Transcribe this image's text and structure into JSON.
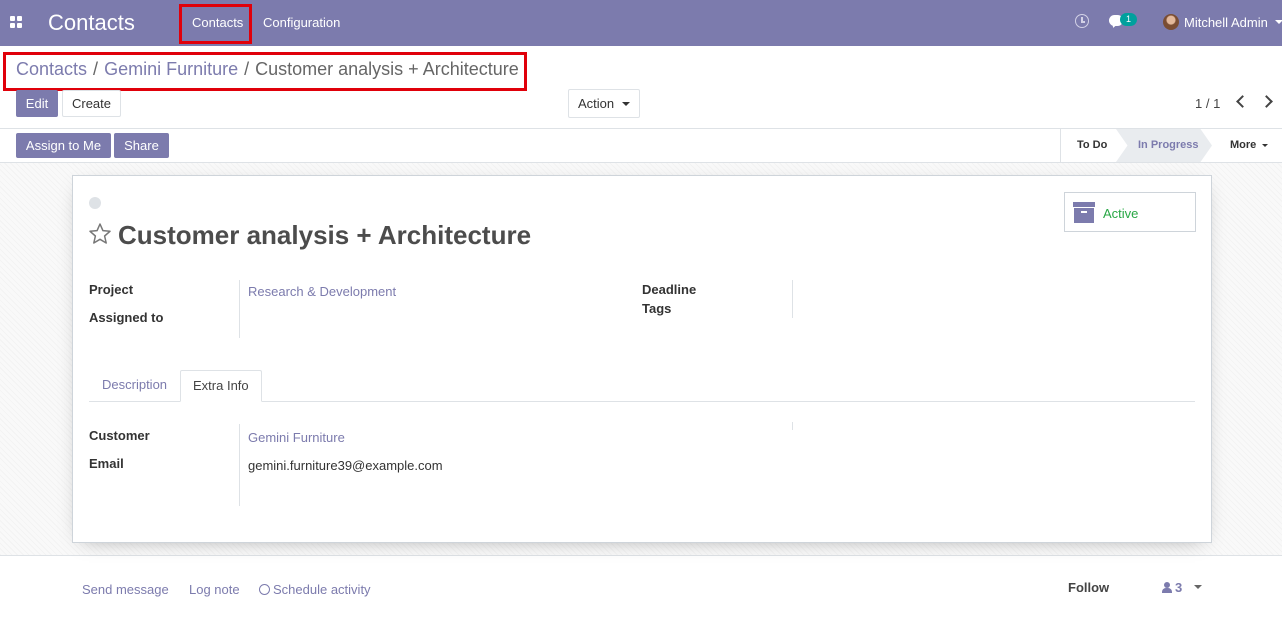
{
  "navbar": {
    "app_title": "Contacts",
    "menu": [
      "Contacts",
      "Configuration"
    ],
    "chat_badge": "1",
    "user_name": "Mitchell Admin",
    "background_color": "#7c7bad"
  },
  "breadcrumb": {
    "items": [
      "Contacts",
      "Gemini Furniture"
    ],
    "separator": "/",
    "current": "Customer analysis + Architecture"
  },
  "toolbar": {
    "edit_label": "Edit",
    "create_label": "Create",
    "action_label": "Action",
    "pager": "1 / 1"
  },
  "statusbar": {
    "assign_label": "Assign to Me",
    "share_label": "Share",
    "stages": [
      "To Do",
      "In Progress"
    ],
    "active_stage": "In Progress",
    "more_label": "More"
  },
  "record": {
    "title": "Customer analysis + Architecture",
    "archive_status": "Active",
    "fields": {
      "project_label": "Project",
      "project_value": "Research & Development",
      "assigned_label": "Assigned to",
      "deadline_label": "Deadline",
      "tags_label": "Tags"
    },
    "tabs": [
      "Description",
      "Extra Info"
    ],
    "active_tab": "Extra Info",
    "extra_info": {
      "customer_label": "Customer",
      "customer_value": "Gemini Furniture",
      "email_label": "Email",
      "email_value": "gemini.furniture39@example.com"
    }
  },
  "chatter": {
    "send_message": "Send message",
    "log_note": "Log note",
    "schedule_activity": "Schedule activity",
    "follow": "Follow",
    "followers_count": "3"
  },
  "colors": {
    "primary": "#7c7bad",
    "active_green": "#28a745",
    "highlight_red": "#e0000a",
    "badge_teal": "#00a09d"
  }
}
